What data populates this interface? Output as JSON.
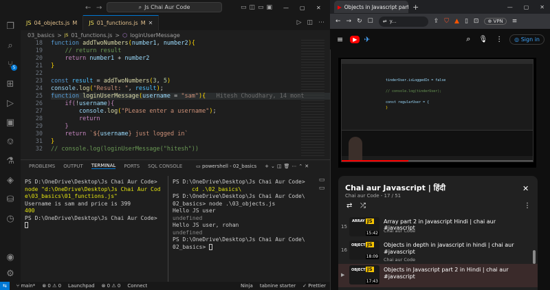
{
  "vscode": {
    "search": "Js Chai Aur Code",
    "tabs": [
      {
        "label": "04_objects.js",
        "badge": "M"
      },
      {
        "label": "01_functions.js",
        "badge": "M"
      }
    ],
    "breadcrumb": [
      "03_basics",
      ">",
      "01_functions.js",
      ">",
      "loginUserMessage"
    ],
    "code_lines": [
      {
        "n": "18",
        "text": "function addTwoNumbers(number1, number2){"
      },
      {
        "n": "19",
        "text": "    // return result"
      },
      {
        "n": "20",
        "text": "    return number1 + number2"
      },
      {
        "n": "21",
        "text": "}"
      },
      {
        "n": "22",
        "text": ""
      },
      {
        "n": "23",
        "text": "const result = addTwoNumbers(3, 5)"
      },
      {
        "n": "24",
        "text": "console.log(\"Result: \", result);"
      },
      {
        "n": "25",
        "text": "function loginUserMessage(username = \"sam\"){"
      },
      {
        "n": "26",
        "text": "    if(!username){"
      },
      {
        "n": "27",
        "text": "        console.log(\"PLease enter a username\");"
      },
      {
        "n": "28",
        "text": "        return"
      },
      {
        "n": "29",
        "text": "    }"
      },
      {
        "n": "30",
        "text": "    return `${username} just logged in`"
      },
      {
        "n": "31",
        "text": "}"
      },
      {
        "n": "32",
        "text": "// console.log(loginUserMessage(\"hitesh\"))"
      }
    ],
    "blame": "Hitesh Choudhary, 14 mont",
    "panel_tabs": [
      "PROBLEMS",
      "OUTPUT",
      "TERMINAL",
      "PORTS",
      "SQL CONSOLE"
    ],
    "terminal_label": "powershell - 02_basics",
    "term1": [
      "PS D:\\OneDrive\\Desktop\\Js Chai Aur Code>",
      "node \"d:\\OneDrive\\Desktop\\Js Chai Aur Code\\03_basics\\01_functions.js\"",
      "Username is sam and price is 399",
      "400",
      "PS D:\\OneDrive\\Desktop\\Js Chai Aur Code>"
    ],
    "term2": [
      "PS D:\\OneDrive\\Desktop\\Js Chai Aur Code>",
      "cd .\\02_basics\\",
      "PS D:\\OneDrive\\Desktop\\Js Chai Aur Code\\",
      "02_basics> node .\\03_objects.js",
      "Hello JS user",
      "undefined",
      "Hello JS user, rohan",
      "undefined",
      "PS D:\\OneDrive\\Desktop\\Js Chai Aur Code\\",
      "02_basics>"
    ],
    "status": {
      "branch": "main*",
      "sync": "0 ⚠ 0",
      "launchpad": "Launchpad",
      "ports": "0 ⚠ 0",
      "connect": "Connect",
      "ninja": "Ninja",
      "tabnine": "tabnine starter",
      "prettier": "Prettier"
    }
  },
  "browser": {
    "tab_title": "Objects in Javascript part 2 i",
    "vpn": "VPN",
    "signin": "Sign in",
    "playlist": {
      "title": "Chai aur Javascript | हिंदी",
      "subtitle": "Chai aur Code - 17 / 51"
    },
    "items": [
      {
        "idx": "15",
        "title": "Array part 2 in Javascript Hindi | chai aur #javascript",
        "channel": "Chai aur Code",
        "duration": "15:42"
      },
      {
        "idx": "16",
        "title": "Objects in depth in javascript in hindi | chai aur #javascript",
        "channel": "Chai aur Code",
        "duration": "18:09"
      },
      {
        "idx": "▶",
        "title": "Objects in Javascript part 2 in Hindi | chai aur #javascript",
        "channel": "Chai aur Code",
        "duration": "17:43"
      }
    ],
    "video_code": [
      "tinderUser.isLoggedIn = false",
      "// console.log(tinderUser);",
      "const regularUser = {",
      "}"
    ]
  },
  "colors": {
    "accent": "#0078d4",
    "yt_red": "#ff0000"
  }
}
